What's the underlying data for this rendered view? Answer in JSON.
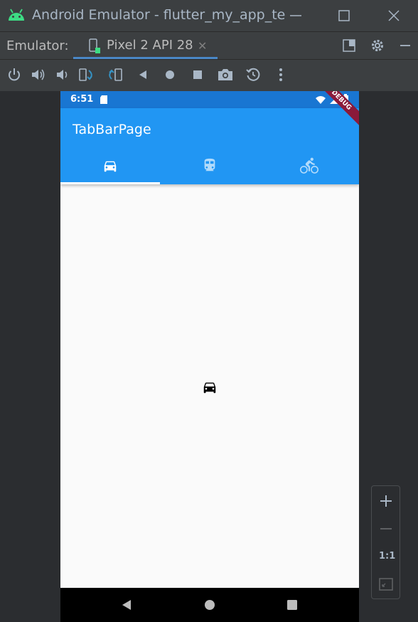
{
  "window": {
    "title": "Android Emulator - flutter_my_app_te"
  },
  "emulator_tabs": {
    "label": "Emulator:",
    "active_device": "Pixel 2 API 28"
  },
  "toolbar": {
    "icons": [
      "power-icon",
      "volume-up-icon",
      "volume-down-icon",
      "rotate-left-icon",
      "rotate-right-icon",
      "back-icon",
      "home-icon",
      "overview-icon",
      "screenshot-icon",
      "snapshot-icon",
      "more-icon"
    ]
  },
  "device": {
    "status_time": "6:51",
    "debug_banner": "DEBUG",
    "app_title": "TabBarPage",
    "tabs": [
      {
        "icon": "car-icon",
        "selected": true
      },
      {
        "icon": "train-icon",
        "selected": false
      },
      {
        "icon": "bike-icon",
        "selected": false
      }
    ],
    "content_icon": "car-icon"
  },
  "zoom_controls": {
    "one_to_one": "1:1"
  },
  "colors": {
    "appbar": "#2196f3",
    "statusbar": "#1976d2",
    "ide_bg": "#3c3f41",
    "tab_indicator": "#4a88c7"
  }
}
